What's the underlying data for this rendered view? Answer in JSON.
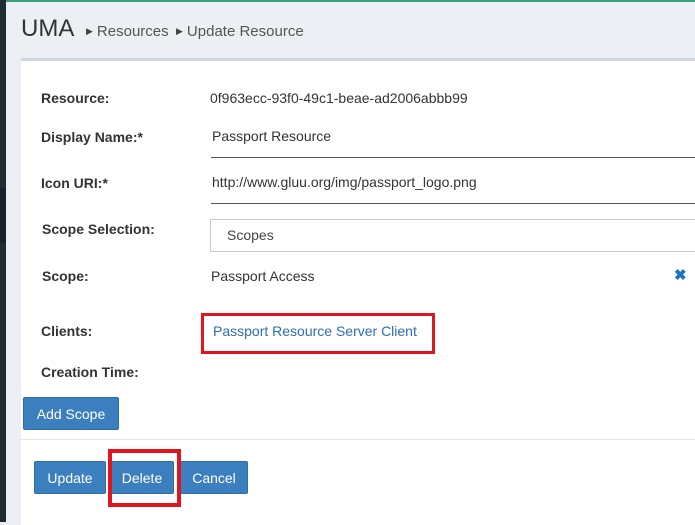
{
  "header": {
    "title": "UMA",
    "breadcrumb": [
      "Resources",
      "Update Resource"
    ]
  },
  "form": {
    "resource_label": "Resource:",
    "resource_value": "0f963ecc-93f0-49c1-beae-ad2006abbb99",
    "display_name_label": "Display Name:*",
    "display_name_value": "Passport Resource",
    "icon_uri_label": "Icon URI:*",
    "icon_uri_value": "http://www.gluu.org/img/passport_logo.png",
    "scope_selection_label": "Scope Selection:",
    "scope_selection_value": "Scopes",
    "scope_label": "Scope:",
    "scope_value": "Passport Access",
    "clients_label": "Clients:",
    "clients_link": "Passport Resource Server Client",
    "creation_time_label": "Creation Time:"
  },
  "buttons": {
    "add_scope": "Add Scope",
    "update": "Update",
    "delete": "Delete",
    "cancel": "Cancel"
  },
  "icons": {
    "remove_scope": "close-icon",
    "breadcrumb_separator": "caret-right-icon"
  },
  "colors": {
    "primary_button": "#3c7fbe",
    "highlight": "#e0151f",
    "link": "#2a6fb1",
    "top_accent": "#3aa07c"
  }
}
